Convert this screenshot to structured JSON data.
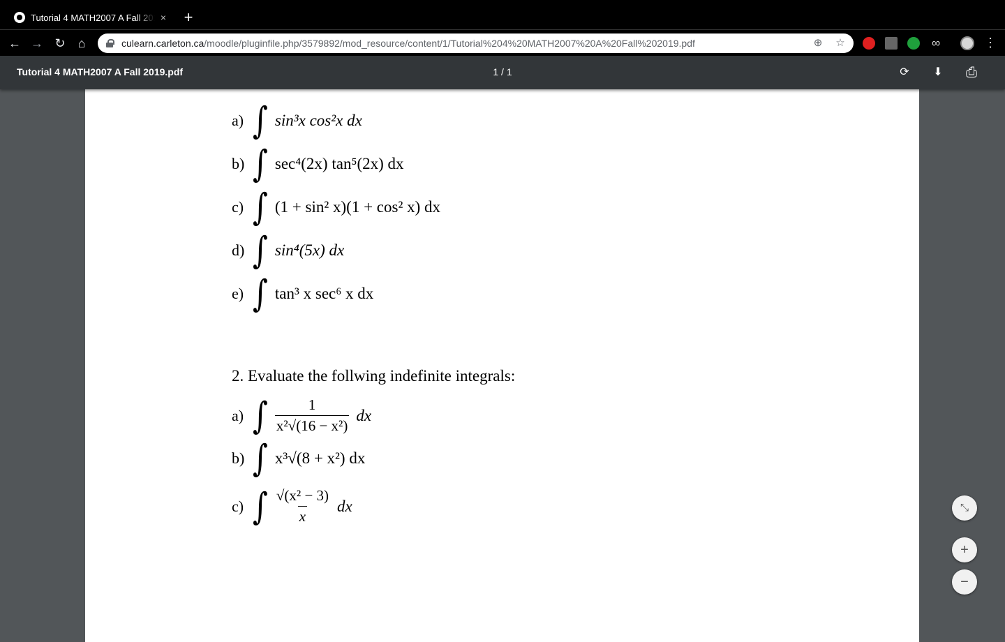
{
  "browser": {
    "tab": {
      "title": "Tutorial 4 MATH2007 A Fall 2019.pdf",
      "close": "×"
    },
    "new_tab": "+",
    "nav": {
      "back": "←",
      "forward": "→",
      "reload": "↻",
      "home": "⌂"
    },
    "url": {
      "host": "culearn.carleton.ca",
      "path": "/moodle/pluginfile.php/3579892/mod_resource/content/1/Tutorial%204%20MATH2007%20A%20Fall%202019.pdf"
    },
    "omnibox_icons": {
      "zoom": "⊕",
      "bookmark": "☆"
    },
    "extensions": {
      "infinity": "∞"
    },
    "menu": "⋮"
  },
  "pdf_viewer": {
    "title": "Tutorial 4 MATH2007 A Fall 2019.pdf",
    "page_indicator": "1 / 1",
    "rotate_icon": "⟳",
    "download_icon": "⬇",
    "print_icon": "⎙",
    "fit_icon": "⤡",
    "zoom_in": "+",
    "zoom_out": "−"
  },
  "document": {
    "problems_1": [
      {
        "label": "a)",
        "expr": "sin³x cos²x dx"
      },
      {
        "label": "b)",
        "expr": "sec⁴(2x) tan⁵(2x) dx"
      },
      {
        "label": "c)",
        "expr": "(1 + sin² x)(1 + cos² x) dx"
      },
      {
        "label": "d)",
        "expr": "sin⁴(5x) dx"
      },
      {
        "label": "e)",
        "expr": "tan³ x  sec⁶ x dx"
      }
    ],
    "heading_2": "2.  Evaluate the follwing indefinite integrals:",
    "problems_2": {
      "a": {
        "label": "a)",
        "numerator": "1",
        "denominator": "x²√(16 − x²)",
        "tail": "dx"
      },
      "b": {
        "label": "b)",
        "expr": "x³√(8 + x²) dx"
      },
      "c": {
        "label": "c)",
        "numerator": "√(x² − 3)",
        "denominator": "x",
        "tail": "dx"
      }
    },
    "integral_sign": "∫"
  }
}
